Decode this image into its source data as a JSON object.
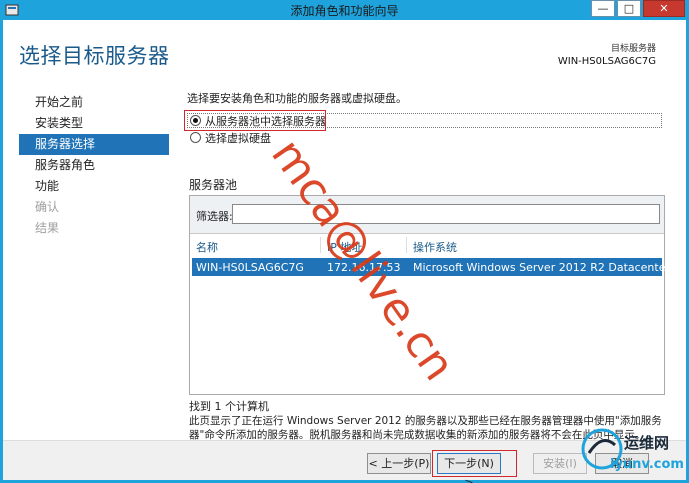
{
  "window": {
    "title": "添加角色和功能向导",
    "minimize": "—",
    "maximize": "□",
    "close": "✕"
  },
  "header": {
    "title": "选择目标服务器",
    "target_label": "目标服务器",
    "target_value": "WIN-HS0LSAG6C7G"
  },
  "nav": {
    "items": [
      {
        "label": "开始之前"
      },
      {
        "label": "安装类型"
      },
      {
        "label": "服务器选择"
      },
      {
        "label": "服务器角色"
      },
      {
        "label": "功能"
      },
      {
        "label": "确认"
      },
      {
        "label": "结果"
      }
    ]
  },
  "main": {
    "prompt": "选择要安装角色和功能的服务器或虚拟硬盘。",
    "options": [
      {
        "label": "从服务器池中选择服务器",
        "checked": true
      },
      {
        "label": "选择虚拟硬盘",
        "checked": false
      }
    ],
    "pool_title": "服务器池",
    "filter_label": "筛选器:",
    "filter_value": "",
    "columns": [
      "名称",
      "IP 地址",
      "操作系统"
    ],
    "rows": [
      [
        "WIN-HS0LSAG6C7G",
        "172.16.17.53",
        "Microsoft Windows Server 2012 R2 Datacenter"
      ]
    ],
    "found": "找到 1 个计算机",
    "description": "此页显示了正在运行 Windows Server 2012 的服务器以及那些已经在服务器管理器中使用\"添加服务器\"命令所添加的服务器。脱机服务器和尚未完成数据收集的新添加的服务器将不会在此页中显示。"
  },
  "footer": {
    "prev": "< 上一步(P)",
    "next": "下一步(N) >",
    "install": "安装(I)",
    "cancel": "取消"
  },
  "watermark": "mca@live.cn",
  "logo": {
    "title": "运维网",
    "sub": "iyunv.com"
  },
  "colors": {
    "accent": "#1f73b6",
    "frame": "#1fa3dc",
    "highlight_box": "#d0282d",
    "watermark": "#d93a18"
  }
}
